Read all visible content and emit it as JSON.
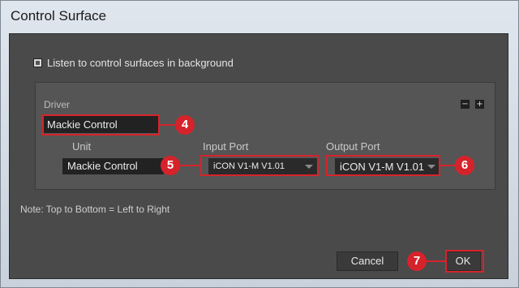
{
  "window": {
    "title": "Control Surface"
  },
  "background_option": {
    "label": "Listen to control surfaces in background",
    "checked": true
  },
  "driver": {
    "label": "Driver",
    "value": "Mackie Control",
    "remove_symbol": "−",
    "add_symbol": "+"
  },
  "columns": {
    "unit": "Unit",
    "input_port": "Input Port",
    "output_port": "Output Port"
  },
  "row": {
    "unit": "Mackie Control",
    "input_port": "iCON V1-M V1.01",
    "output_port": "iCON V1-M V1.01"
  },
  "note": "Note: Top to Bottom = Left to Right",
  "buttons": {
    "cancel": "Cancel",
    "ok": "OK"
  },
  "callouts": {
    "driver": "4",
    "input": "5",
    "output": "6",
    "ok": "7"
  },
  "colors": {
    "highlight": "#d6232b",
    "panel": "#555555",
    "client": "#4a4a4a"
  }
}
